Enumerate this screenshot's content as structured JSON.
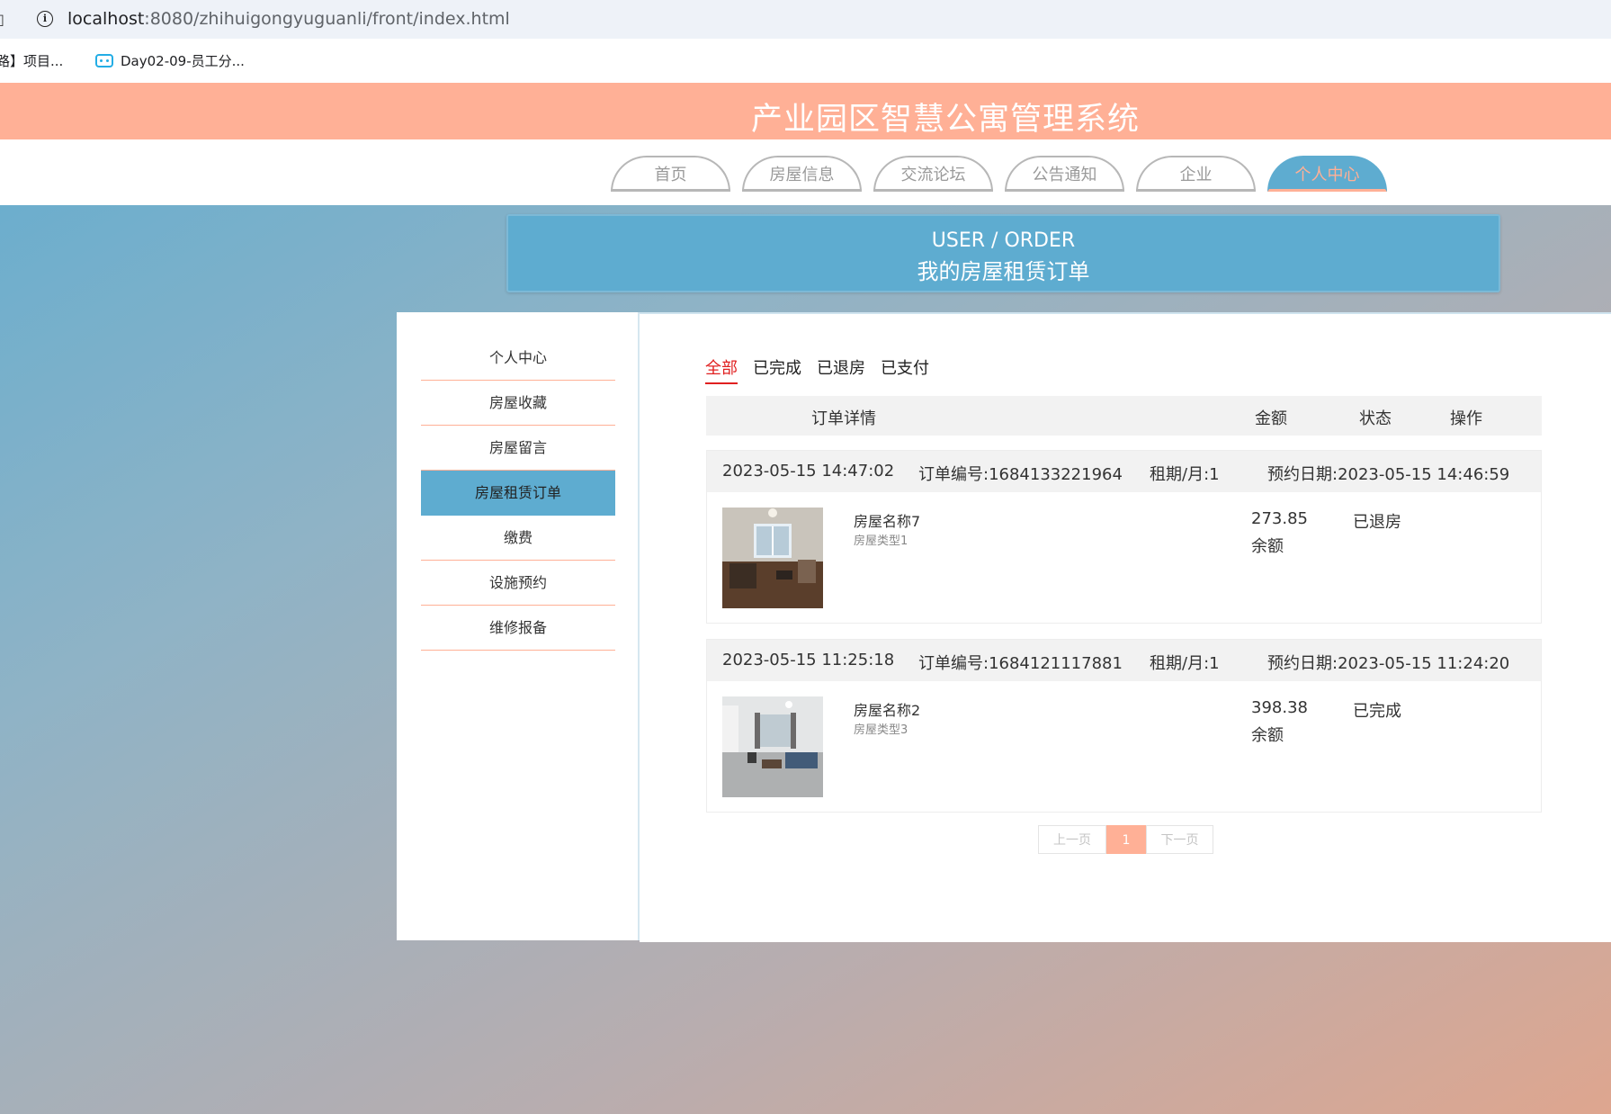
{
  "browser": {
    "url_host": "localhost",
    "url_rest": ":8080/zhihuigongyuguanli/front/index.html",
    "bookmarks": [
      "路】项目...",
      "Day02-09-员工分..."
    ]
  },
  "site": {
    "title": "产业园区智慧公寓管理系统",
    "nav": [
      "首页",
      "房屋信息",
      "交流论坛",
      "公告通知",
      "企业",
      "个人中心"
    ],
    "nav_active": "个人中心"
  },
  "banner": {
    "en": "USER / ORDER",
    "cn": "我的房屋租赁订单"
  },
  "sidebar": {
    "items": [
      "个人中心",
      "房屋收藏",
      "房屋留言",
      "房屋租赁订单",
      "缴费",
      "设施预约",
      "维修报备"
    ],
    "active": "房屋租赁订单"
  },
  "tabs": {
    "items": [
      "全部",
      "已完成",
      "已退房",
      "已支付"
    ],
    "active": "全部"
  },
  "table_header": {
    "detail": "订单详情",
    "amount": "金额",
    "status": "状态",
    "action": "操作"
  },
  "orders": [
    {
      "time": "2023-05-15 14:47:02",
      "order_no": "订单编号:1684133221964",
      "term": "租期/月:1",
      "booking": "预约日期:2023-05-15 14:46:59",
      "name": "房屋名称7",
      "type": "房屋类型1",
      "amount": "273.85",
      "balance_label": "余额",
      "status": "已退房"
    },
    {
      "time": "2023-05-15 11:25:18",
      "order_no": "订单编号:1684121117881",
      "term": "租期/月:1",
      "booking": "预约日期:2023-05-15 11:24:20",
      "name": "房屋名称2",
      "type": "房屋类型3",
      "amount": "398.38",
      "balance_label": "余额",
      "status": "已完成"
    }
  ],
  "pager": {
    "prev": "上一页",
    "current": "1",
    "next": "下一页"
  },
  "colors": {
    "accent_blue": "#5eacd0",
    "accent_peach": "#ffb096",
    "active_tab_red": "#e02020"
  },
  "icons": {
    "info": "info-icon",
    "bookmark": "bilibili-tv-icon"
  }
}
